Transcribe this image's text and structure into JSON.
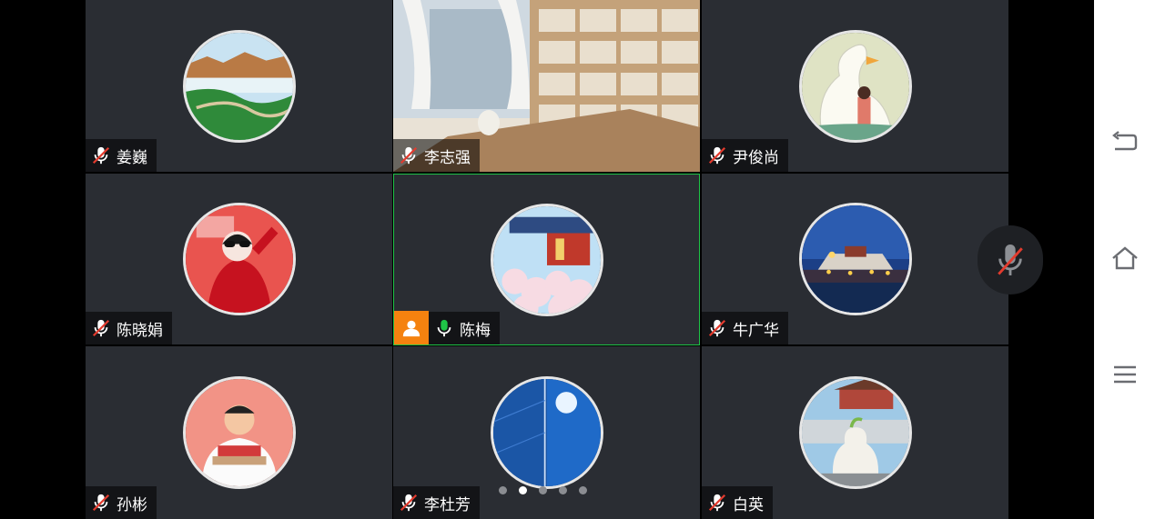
{
  "participants": [
    {
      "name": "姜巍",
      "mic": "muted"
    },
    {
      "name": "李志强",
      "mic": "muted"
    },
    {
      "name": "尹俊尚",
      "mic": "muted"
    },
    {
      "name": "陈晓娟",
      "mic": "muted"
    },
    {
      "name": "陈梅",
      "mic": "on",
      "host": true,
      "speaking": true
    },
    {
      "name": "牛广华",
      "mic": "muted"
    },
    {
      "name": "孙彬",
      "mic": "muted"
    },
    {
      "name": "李杜芳",
      "mic": "muted"
    },
    {
      "name": "白英",
      "mic": "muted"
    }
  ],
  "pager": {
    "count": 5,
    "active": 1
  },
  "controls": {
    "floating_mic": "muted"
  },
  "nav": {
    "icons": [
      "back-icon",
      "home-icon",
      "menu-icon"
    ]
  },
  "colors": {
    "active_border": "#1fc447",
    "host_badge": "#f5820f",
    "mic_on": "#1fc447",
    "mic_muted_slash": "#e33b2e"
  }
}
